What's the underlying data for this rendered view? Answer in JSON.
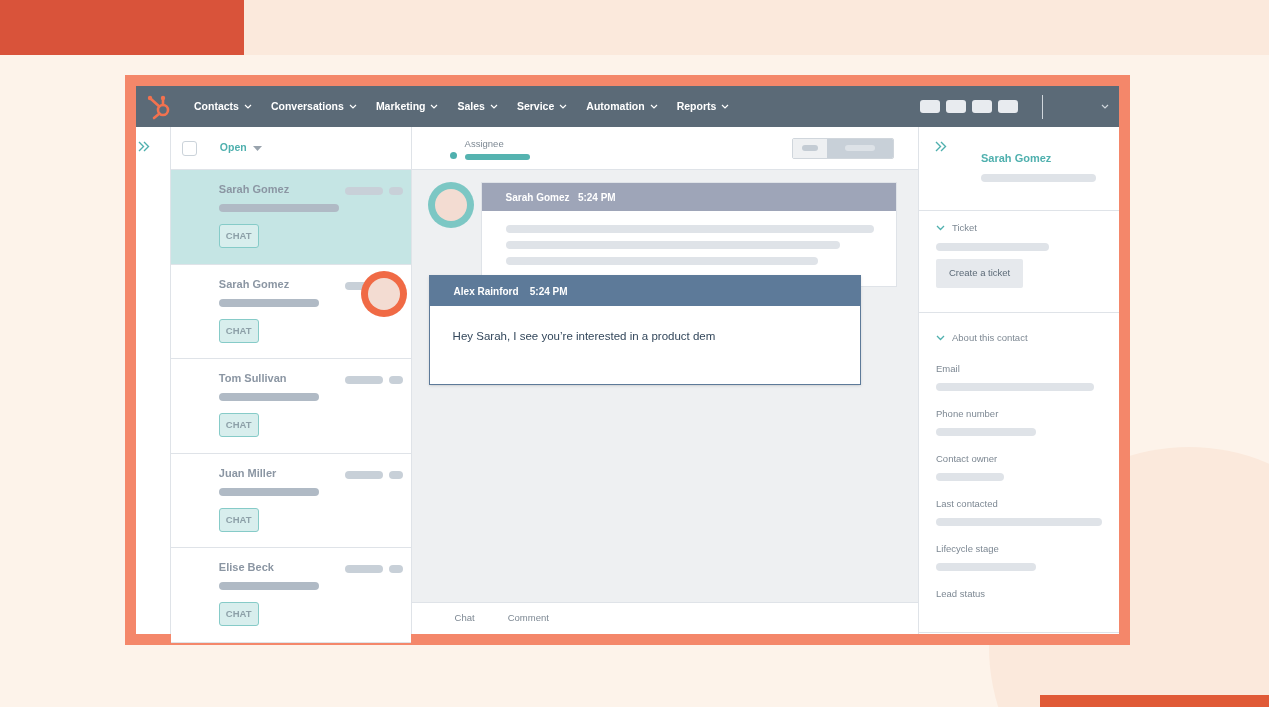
{
  "nav": {
    "items": [
      {
        "label": "Contacts"
      },
      {
        "label": "Conversations"
      },
      {
        "label": "Marketing"
      },
      {
        "label": "Sales"
      },
      {
        "label": "Service"
      },
      {
        "label": "Automation"
      },
      {
        "label": "Reports"
      }
    ]
  },
  "inbox": {
    "select_all": {
      "checked": false
    },
    "filter": "Open",
    "conversations": [
      {
        "name": "Sarah Gomez",
        "tag": "CHAT",
        "selected": true,
        "avatar": false
      },
      {
        "name": "Sarah Gomez",
        "tag": "CHAT",
        "selected": false,
        "avatar": true
      },
      {
        "name": "Tom Sullivan",
        "tag": "CHAT",
        "selected": false,
        "avatar": false
      },
      {
        "name": "Juan Miller",
        "tag": "CHAT",
        "selected": false,
        "avatar": false
      },
      {
        "name": "Elise Beck",
        "tag": "CHAT",
        "selected": false,
        "avatar": false
      }
    ]
  },
  "thread": {
    "assignee_label": "Assignee",
    "messages": [
      {
        "kind": "incoming",
        "sender": "Sarah Gomez",
        "time": "5:24 PM"
      },
      {
        "kind": "reply",
        "sender": "Alex Rainford",
        "time": "5:24 PM",
        "text": "Hey Sarah, I see you’re interested in a product dem"
      }
    ],
    "compose_tabs": [
      {
        "label": "Chat"
      },
      {
        "label": "Comment"
      }
    ]
  },
  "contact": {
    "name": "Sarah Gomez",
    "ticket": {
      "title": "Ticket",
      "button": "Create a ticket"
    },
    "about": {
      "title": "About this contact",
      "fields": [
        {
          "label": "Email"
        },
        {
          "label": "Phone number"
        },
        {
          "label": "Contact owner"
        },
        {
          "label": "Last contacted"
        },
        {
          "label": "Lifecycle stage"
        },
        {
          "label": "Lead status"
        }
      ]
    }
  }
}
